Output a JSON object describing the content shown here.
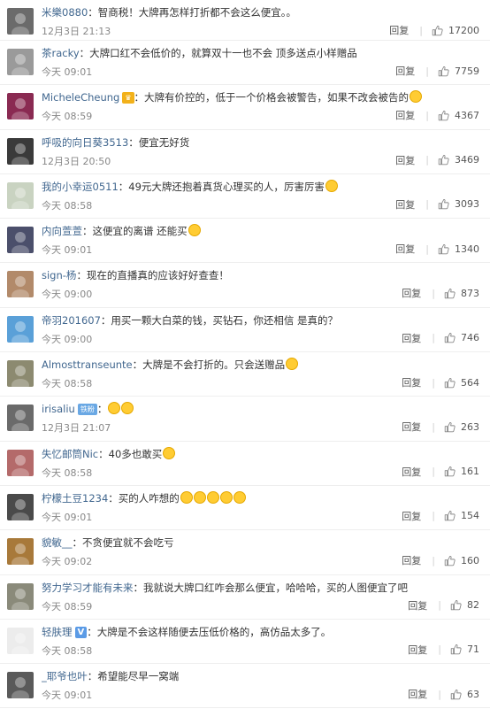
{
  "reply_label": "回复",
  "comments": [
    {
      "user": "米樂0880",
      "badge": "",
      "text": "：智商税！大牌再怎样打折都不会这么便宜。。",
      "emojis": 0,
      "time": "12月3日 21:13",
      "likes": "17200",
      "avatar_color": "#6b6b6b"
    },
    {
      "user": "茶racky",
      "badge": "",
      "text": "：大牌口红不会低价的，就算双十一也不会 顶多送点小样赠品",
      "emojis": 0,
      "time": "今天 09:01",
      "likes": "7759",
      "avatar_color": "#9a9a9a"
    },
    {
      "user": "MicheleCheung",
      "badge": "crown",
      "text": "：大牌有价控的，低于一个价格会被警告，如果不改会被告的",
      "emojis": 1,
      "time": "今天 08:59",
      "likes": "4367",
      "avatar_color": "#8a2a52"
    },
    {
      "user": "呼吸的向日葵3513",
      "badge": "",
      "text": "：便宜无好货",
      "emojis": 0,
      "time": "12月3日 20:50",
      "likes": "3469",
      "avatar_color": "#3a3a3a"
    },
    {
      "user": "我的小幸运0511",
      "badge": "",
      "text": "：49元大牌还抱着真货心理买的人，厉害厉害",
      "emojis": 1,
      "time": "今天 08:58",
      "likes": "3093",
      "avatar_color": "#c9d3c1"
    },
    {
      "user": "内向萱萱",
      "badge": "",
      "text": "：这便宜的离谱  还能买",
      "emojis": 1,
      "time": "今天 09:01",
      "likes": "1340",
      "avatar_color": "#4b4f6b"
    },
    {
      "user": "sign-杨",
      "badge": "",
      "text": "：现在的直播真的应该好好查查！",
      "emojis": 0,
      "time": "今天 09:00",
      "likes": "873",
      "avatar_color": "#b28a6a"
    },
    {
      "user": "帝羽201607",
      "badge": "",
      "text": "：用买一颗大白菜的钱，买钻石，你还相信 是真的？",
      "emojis": 0,
      "time": "今天 09:00",
      "likes": "746",
      "avatar_color": "#5aa0d8"
    },
    {
      "user": "Almosttranseunte",
      "badge": "",
      "text": "：大牌是不会打折的。只会送赠品",
      "emojis": 1,
      "time": "今天 08:58",
      "likes": "564",
      "avatar_color": "#8c8a70"
    },
    {
      "user": "irisaliu",
      "badge": "tag",
      "badge_text": "铁粉",
      "text": "：",
      "emojis": 2,
      "time": "12月3日 21:07",
      "likes": "263",
      "avatar_color": "#6a6a6a"
    },
    {
      "user": "失忆邮筒Nic",
      "badge": "",
      "text": "：40多也敢买",
      "emojis": 1,
      "time": "今天 08:58",
      "likes": "161",
      "avatar_color": "#b46a6a"
    },
    {
      "user": "柠檬土豆1234",
      "badge": "",
      "text": "：买的人咋想的",
      "emojis": 5,
      "time": "今天 09:01",
      "likes": "154",
      "avatar_color": "#4a4a4a"
    },
    {
      "user": "貌敏__",
      "badge": "",
      "text": "：不贪便宜就不会吃亏",
      "emojis": 0,
      "time": "今天 09:02",
      "likes": "160",
      "avatar_color": "#a8793a"
    },
    {
      "user": "努力学习才能有未来",
      "badge": "",
      "text": "：我就说大牌口红咋会那么便宜，哈哈哈，买的人图便宜了吧",
      "emojis": 0,
      "time": "今天 08:59",
      "likes": "82",
      "avatar_color": "#8a8a7a"
    },
    {
      "user": "轻肤理",
      "badge": "v",
      "badge_text": "V",
      "text": "：大牌是不会这样随便去压低价格的，高仿品太多了。",
      "emojis": 0,
      "time": "今天 08:58",
      "likes": "71",
      "avatar_color": "#ececec"
    },
    {
      "user": "_耶爷也叶",
      "badge": "",
      "text": "：希望能尽早一窝端",
      "emojis": 0,
      "time": "今天 09:01",
      "likes": "63",
      "avatar_color": "#5a5a5a"
    }
  ]
}
